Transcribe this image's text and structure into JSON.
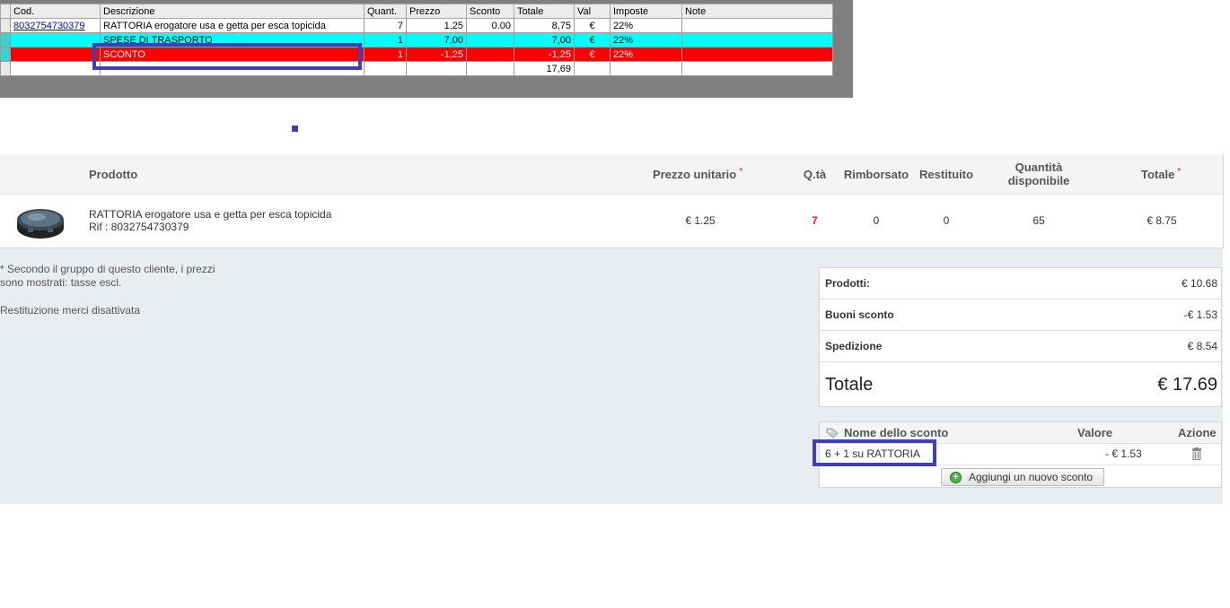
{
  "legacy_grid": {
    "headers": [
      "Cod.",
      "Descrizione",
      "Quant.",
      "Prezzo",
      "Sconto",
      "Totale",
      "Val",
      "Imposte",
      "Note"
    ],
    "rows": [
      {
        "code": "8032754730379",
        "desc": "RATTORIA erogatore usa e getta per esca topicida",
        "qty": "7",
        "price": "1,25",
        "discount": "0.00",
        "total": "8,75",
        "currency": "€",
        "tax": "22%",
        "note": ""
      },
      {
        "code": "",
        "desc": "SPESE DI TRASPORTO",
        "qty": "1",
        "price": "7,00",
        "discount": "",
        "total": "7,00",
        "currency": "€",
        "tax": "22%",
        "note": ""
      },
      {
        "code": "",
        "desc": "SCONTO",
        "qty": "1",
        "price": "-1,25",
        "discount": "",
        "total": "-1,25",
        "currency": "€",
        "tax": "22%",
        "note": ""
      }
    ],
    "grand_total": "17,69",
    "colors": {
      "shipping_row": "#00ffff",
      "discount_row": "#ff0000",
      "background": "#7f7f7f",
      "highlight": "#3f3fb6"
    }
  },
  "products": {
    "headers": {
      "product": "Prodotto",
      "unit_price": "Prezzo unitario",
      "qty": "Q.tà",
      "refunded": "Rimborsato",
      "returned": "Restituito",
      "available": "Quantità disponibile",
      "total": "Totale",
      "required_mark": "*"
    },
    "item": {
      "name": "RATTORIA erogatore usa e getta per esca topicida",
      "ref": "Rif : 8032754730379",
      "unit_price": "€ 1.25",
      "qty": "7",
      "refunded": "0",
      "returned": "0",
      "available": "65",
      "total": "€ 8.75",
      "image_icon": "product-thumbnail"
    }
  },
  "notes": {
    "line1": "* Secondo il gruppo di questo cliente, i prezzi",
    "line2": "sono mostrati: tasse escl.",
    "returns": "Restituzione merci disattivata"
  },
  "totals": {
    "products_label": "Prodotti:",
    "products_value": "€ 10.68",
    "vouchers_label": "Buoni sconto",
    "vouchers_value": "-€ 1.53",
    "shipping_label": "Spedizione",
    "shipping_value": "€ 8.54",
    "total_label": "Totale",
    "total_value": "€ 17.69"
  },
  "discounts": {
    "headers": {
      "name": "Nome dello sconto",
      "value": "Valore",
      "action": "Azione"
    },
    "rows": [
      {
        "name": "6 + 1 su RATTORIA",
        "value": "- € 1.53",
        "action_icon": "trash-icon"
      }
    ],
    "add_button": "Aggiungi un nuovo sconto"
  }
}
